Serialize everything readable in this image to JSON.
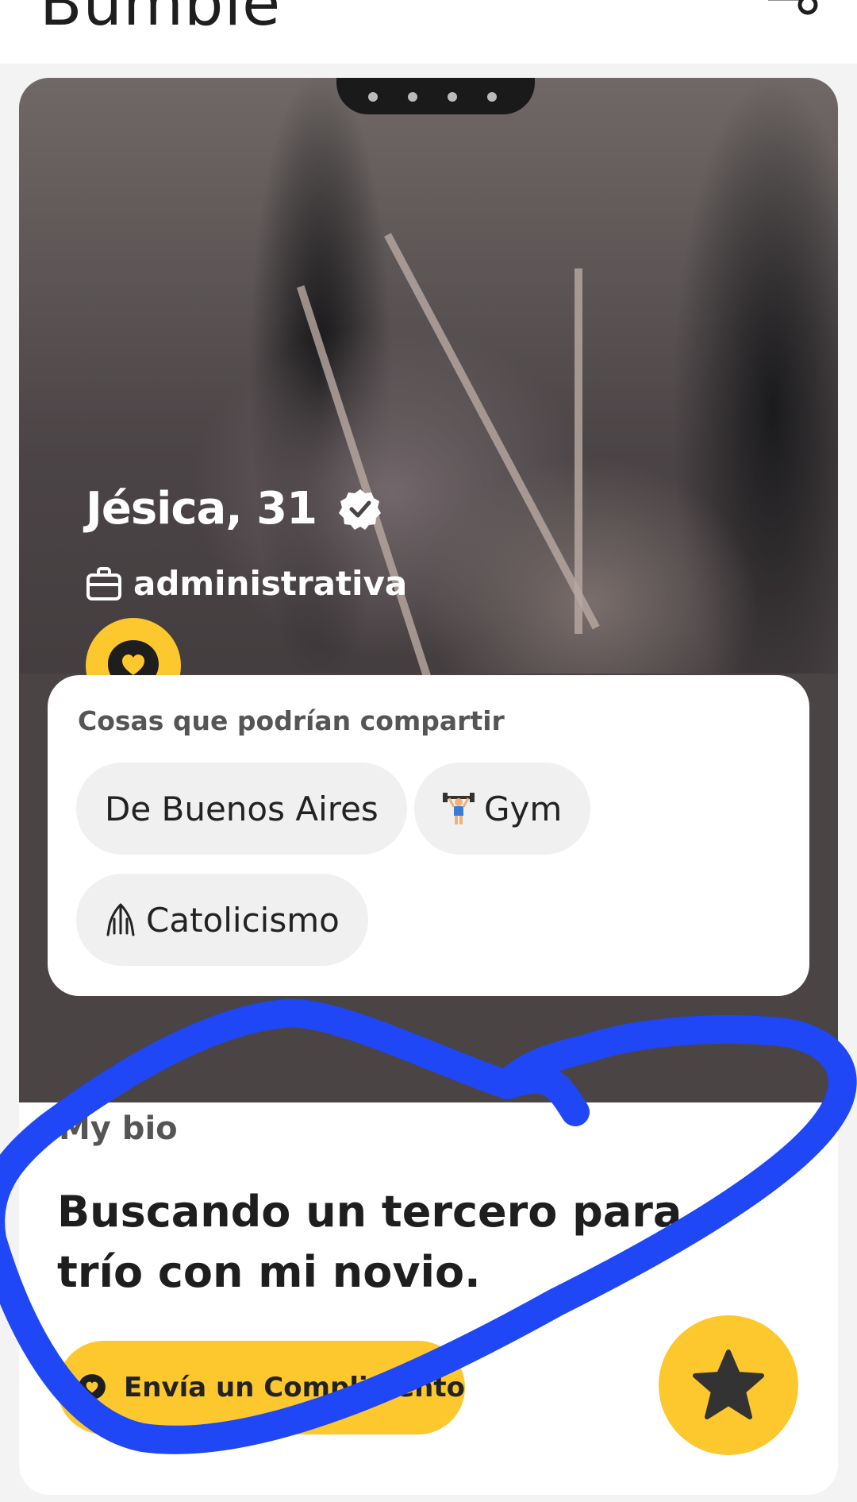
{
  "app": {
    "logo_text": "Bumble"
  },
  "profile": {
    "name_age": "Jésica, 31",
    "verified": true,
    "job": "administrativa"
  },
  "shared": {
    "title": "Cosas que podrían compartir",
    "chips": [
      {
        "label": "De Buenos Aires",
        "icon": ""
      },
      {
        "label": "Gym",
        "icon": "weightlifter-emoji"
      },
      {
        "label": "Catolicismo",
        "icon": "praying-hands-icon"
      }
    ]
  },
  "bio": {
    "label": "My bio",
    "text": "Buscando un tercero para trío con mi novio."
  },
  "actions": {
    "compliment_label": "Envía un Complimento"
  },
  "colors": {
    "accent": "#fdc72e",
    "annotation": "#1f47f5",
    "text_dark": "#1e1e1e",
    "text_muted": "#555555",
    "chip_bg": "#f0f0f0"
  }
}
